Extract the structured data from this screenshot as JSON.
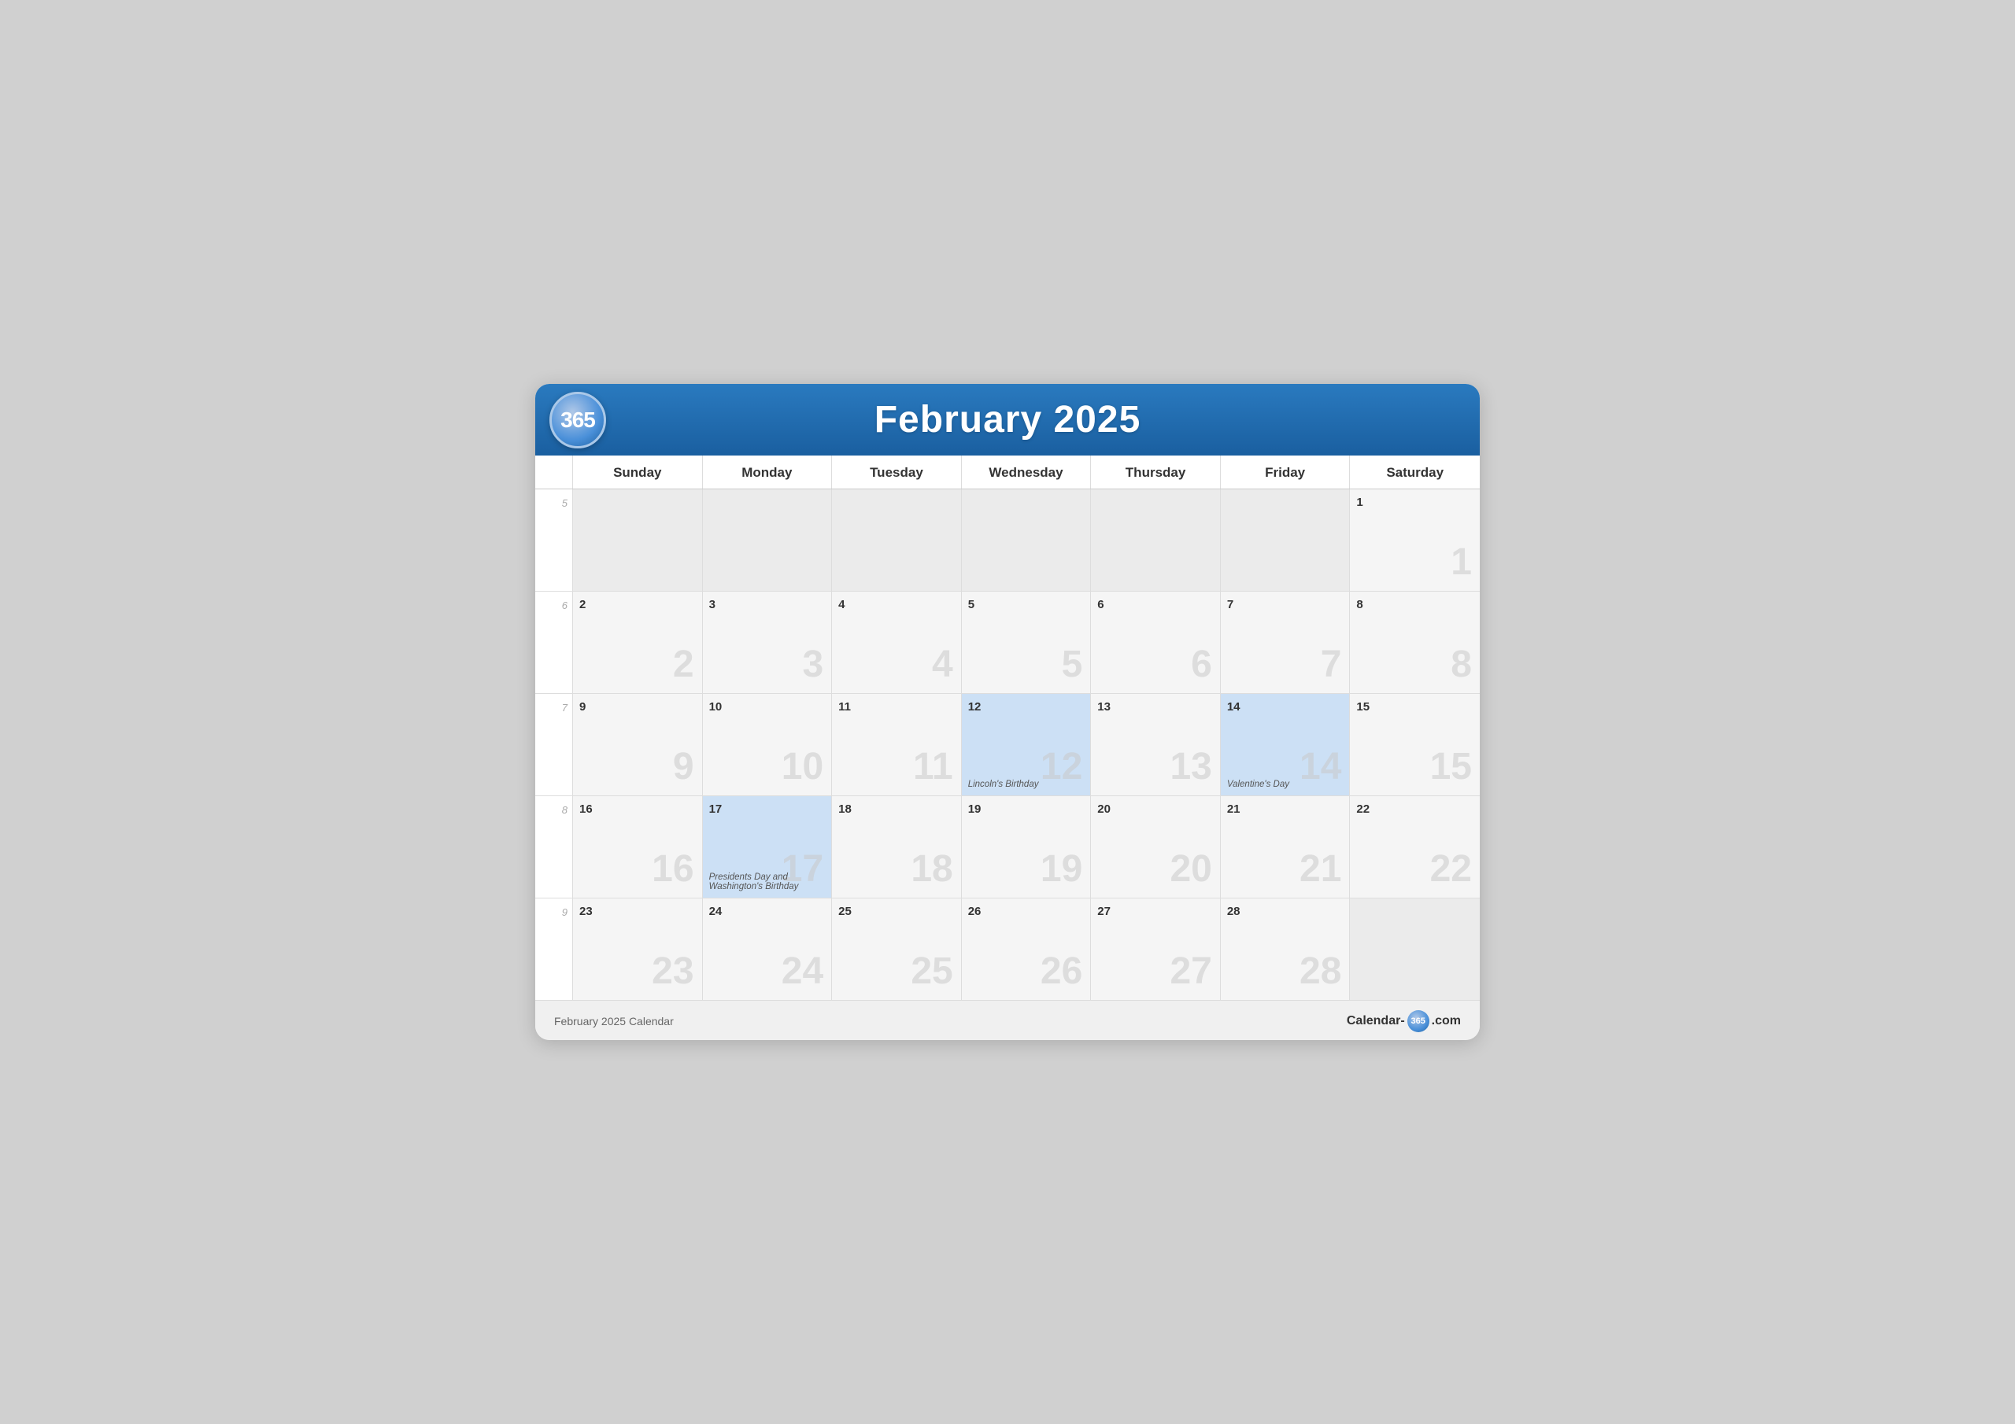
{
  "header": {
    "logo": "365",
    "title": "February 2025"
  },
  "day_headers": [
    "Sunday",
    "Monday",
    "Tuesday",
    "Wednesday",
    "Thursday",
    "Friday",
    "Saturday"
  ],
  "weeks": [
    {
      "week_number": "5",
      "days": [
        {
          "date": "",
          "month": "other",
          "watermark": "",
          "event": ""
        },
        {
          "date": "",
          "month": "other",
          "watermark": "",
          "event": ""
        },
        {
          "date": "",
          "month": "other",
          "watermark": "",
          "event": ""
        },
        {
          "date": "",
          "month": "other",
          "watermark": "",
          "event": ""
        },
        {
          "date": "",
          "month": "other",
          "watermark": "",
          "event": ""
        },
        {
          "date": "",
          "month": "other",
          "watermark": "",
          "event": ""
        },
        {
          "date": "1",
          "month": "current",
          "watermark": "1",
          "event": ""
        }
      ]
    },
    {
      "week_number": "6",
      "days": [
        {
          "date": "2",
          "month": "current",
          "watermark": "2",
          "event": ""
        },
        {
          "date": "3",
          "month": "current",
          "watermark": "3",
          "event": ""
        },
        {
          "date": "4",
          "month": "current",
          "watermark": "4",
          "event": ""
        },
        {
          "date": "5",
          "month": "current",
          "watermark": "5",
          "event": ""
        },
        {
          "date": "6",
          "month": "current",
          "watermark": "6",
          "event": ""
        },
        {
          "date": "7",
          "month": "current",
          "watermark": "7",
          "event": ""
        },
        {
          "date": "8",
          "month": "current",
          "watermark": "8",
          "event": ""
        }
      ]
    },
    {
      "week_number": "7",
      "days": [
        {
          "date": "9",
          "month": "current",
          "watermark": "9",
          "event": ""
        },
        {
          "date": "10",
          "month": "current",
          "watermark": "10",
          "event": ""
        },
        {
          "date": "11",
          "month": "current",
          "watermark": "11",
          "event": ""
        },
        {
          "date": "12",
          "month": "blue",
          "watermark": "12",
          "event": "Lincoln's Birthday"
        },
        {
          "date": "13",
          "month": "current",
          "watermark": "13",
          "event": ""
        },
        {
          "date": "14",
          "month": "blue",
          "watermark": "14",
          "event": "Valentine's Day"
        },
        {
          "date": "15",
          "month": "current",
          "watermark": "15",
          "event": ""
        }
      ]
    },
    {
      "week_number": "8",
      "days": [
        {
          "date": "16",
          "month": "current",
          "watermark": "16",
          "event": ""
        },
        {
          "date": "17",
          "month": "blue",
          "watermark": "17",
          "event": "Presidents Day and Washington's Birthday"
        },
        {
          "date": "18",
          "month": "current",
          "watermark": "18",
          "event": ""
        },
        {
          "date": "19",
          "month": "current",
          "watermark": "19",
          "event": ""
        },
        {
          "date": "20",
          "month": "current",
          "watermark": "20",
          "event": ""
        },
        {
          "date": "21",
          "month": "current",
          "watermark": "21",
          "event": ""
        },
        {
          "date": "22",
          "month": "current",
          "watermark": "22",
          "event": ""
        }
      ]
    },
    {
      "week_number": "9",
      "days": [
        {
          "date": "23",
          "month": "current",
          "watermark": "23",
          "event": ""
        },
        {
          "date": "24",
          "month": "current",
          "watermark": "24",
          "event": ""
        },
        {
          "date": "25",
          "month": "current",
          "watermark": "25",
          "event": ""
        },
        {
          "date": "26",
          "month": "current",
          "watermark": "26",
          "event": ""
        },
        {
          "date": "27",
          "month": "current",
          "watermark": "27",
          "event": ""
        },
        {
          "date": "28",
          "month": "current",
          "watermark": "28",
          "event": ""
        },
        {
          "date": "",
          "month": "other",
          "watermark": "",
          "event": ""
        }
      ]
    }
  ],
  "footer": {
    "left": "February 2025 Calendar",
    "right_prefix": "Calendar-",
    "right_badge": "365",
    "right_suffix": ".com"
  }
}
